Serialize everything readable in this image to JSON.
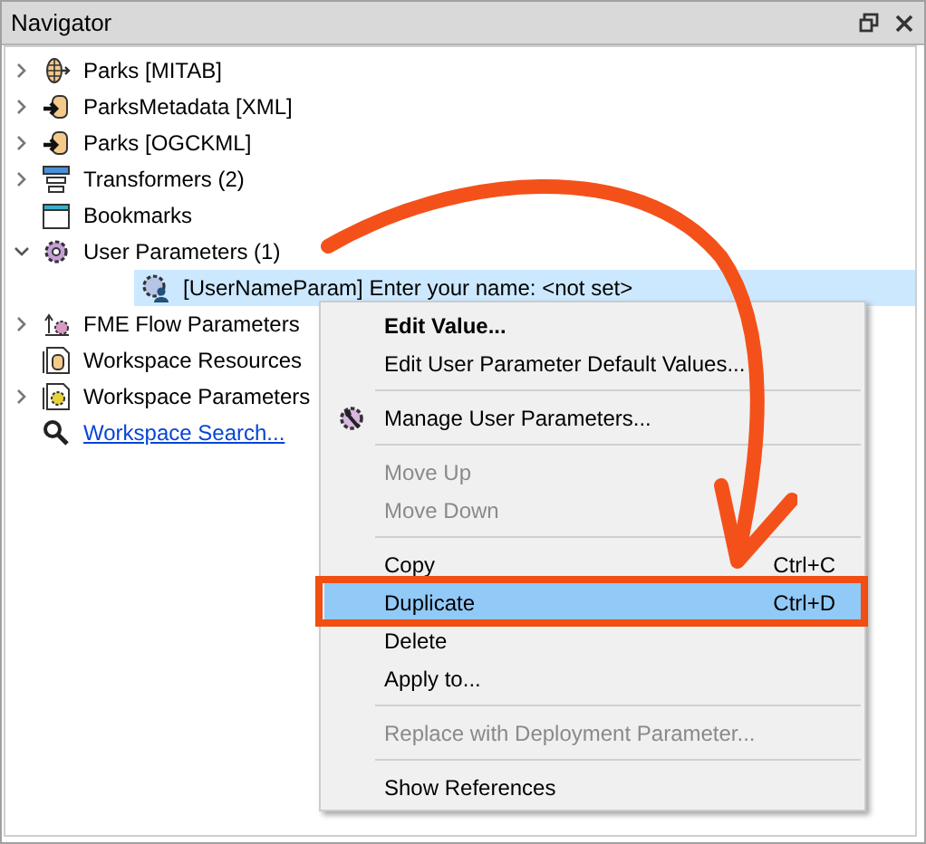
{
  "window": {
    "title": "Navigator"
  },
  "tree": [
    {
      "label": "Parks [MITAB]",
      "kind": "reader_mitab",
      "expanded": false,
      "selected": false
    },
    {
      "label": "ParksMetadata [XML]",
      "kind": "reader",
      "expanded": false,
      "selected": false
    },
    {
      "label": "Parks [OGCKML]",
      "kind": "reader",
      "expanded": false,
      "selected": false
    },
    {
      "label": "Transformers (2)",
      "kind": "transformers",
      "expanded": false,
      "selected": false
    },
    {
      "label": "Bookmarks",
      "kind": "bookmarks",
      "selected": false
    },
    {
      "label": "User Parameters (1)",
      "kind": "parameters",
      "expanded": true,
      "selected": false,
      "children": [
        {
          "label": "[UserNameParam] Enter your name: <not set>",
          "kind": "user_param",
          "selected": true
        }
      ]
    },
    {
      "label": "FME Flow Parameters",
      "kind": "flow",
      "expanded": false,
      "selected": false
    },
    {
      "label": "Workspace Resources",
      "kind": "resources",
      "selected": false
    },
    {
      "label": "Workspace Parameters",
      "kind": "workspace",
      "expanded": false,
      "selected": false
    },
    {
      "label": "Workspace Search...",
      "kind": "link",
      "selected": false
    }
  ],
  "context_menu": [
    {
      "kind": "item",
      "label": "Edit Value...",
      "bold": true,
      "disabled": false,
      "selected": false,
      "callout": false
    },
    {
      "kind": "item",
      "label": "Edit User Parameter Default Values...",
      "bold": false,
      "disabled": false,
      "selected": false,
      "callout": false
    },
    {
      "kind": "separator"
    },
    {
      "kind": "item",
      "label": "Manage User Parameters...",
      "icon": true,
      "bold": false,
      "disabled": false,
      "selected": false,
      "callout": false
    },
    {
      "kind": "separator"
    },
    {
      "kind": "item",
      "label": "Move Up",
      "bold": false,
      "disabled": true,
      "selected": false,
      "callout": false
    },
    {
      "kind": "item",
      "label": "Move Down",
      "bold": false,
      "disabled": true,
      "selected": false,
      "callout": false
    },
    {
      "kind": "separator"
    },
    {
      "kind": "item",
      "label": "Copy",
      "shortcut": "Ctrl+C",
      "bold": false,
      "disabled": false,
      "selected": false,
      "callout": false
    },
    {
      "kind": "item",
      "label": "Duplicate",
      "shortcut": "Ctrl+D",
      "bold": false,
      "disabled": false,
      "selected": true,
      "callout": true
    },
    {
      "kind": "item",
      "label": "Delete",
      "bold": false,
      "disabled": false,
      "selected": false,
      "callout": false
    },
    {
      "kind": "item",
      "label": "Apply to...",
      "bold": false,
      "disabled": false,
      "selected": false,
      "callout": false
    },
    {
      "kind": "separator"
    },
    {
      "kind": "item",
      "label": "Replace with Deployment Parameter...",
      "bold": false,
      "disabled": true,
      "selected": false,
      "callout": false
    },
    {
      "kind": "separator"
    },
    {
      "kind": "item",
      "label": "Show References",
      "bold": false,
      "disabled": false,
      "selected": false,
      "callout": false
    }
  ],
  "annotation": {
    "kind": "arrow"
  }
}
